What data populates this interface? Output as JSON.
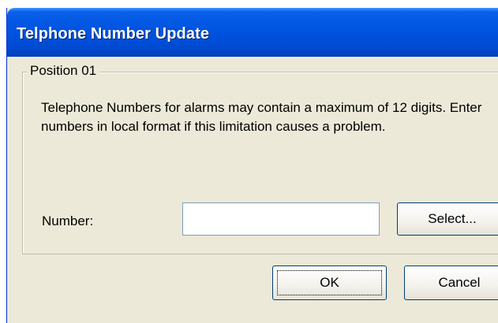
{
  "window": {
    "title": "Telphone Number Update"
  },
  "group": {
    "legend": "Position 01",
    "message": "Telephone Numbers for alarms may contain a maximum of 12 digits. Enter numbers in local format if this limitation causes a problem."
  },
  "number_field": {
    "label": "Number:",
    "value": "",
    "select_label": "Select..."
  },
  "buttons": {
    "ok_label": "OK",
    "cancel_label": "Cancel"
  },
  "colors": {
    "titlebar": "#0054e3",
    "dialog_background": "#ece9d8",
    "button_border": "#003c74"
  }
}
